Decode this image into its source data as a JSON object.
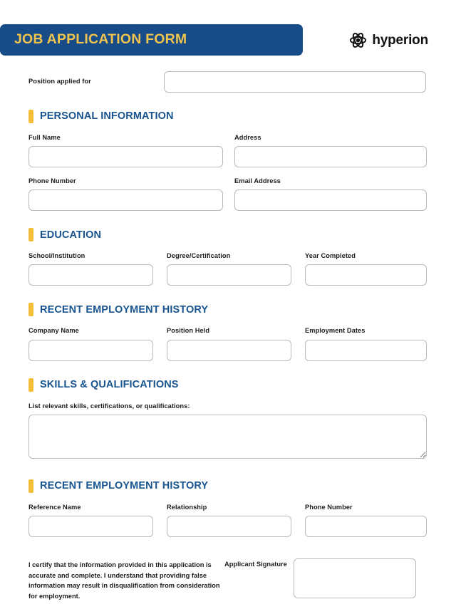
{
  "header": {
    "title": "JOB APPLICATION FORM",
    "brand_name": "hyperion",
    "brand_icon": "atom-icon",
    "bar_color": "#174c89",
    "title_color": "#efc44e",
    "accent_color": "#f5be39",
    "section_title_color": "#18548f"
  },
  "position": {
    "label": "Position applied for",
    "value": "",
    "placeholder": ""
  },
  "sections": [
    {
      "title": "PERSONAL INFORMATION",
      "fields": [
        {
          "label": "Full Name",
          "value": "",
          "placeholder": ""
        },
        {
          "label": "Address",
          "value": "",
          "placeholder": ""
        },
        {
          "label": "Phone Number",
          "value": "",
          "placeholder": ""
        },
        {
          "label": "Email Address",
          "value": "",
          "placeholder": ""
        }
      ]
    },
    {
      "title": "EDUCATION",
      "fields": [
        {
          "label": "School/Institution",
          "value": "",
          "placeholder": ""
        },
        {
          "label": "Degree/Certification",
          "value": "",
          "placeholder": ""
        },
        {
          "label": "Year Completed",
          "value": "",
          "placeholder": ""
        }
      ]
    },
    {
      "title": "RECENT EMPLOYMENT HISTORY",
      "fields": [
        {
          "label": "Company Name",
          "value": "",
          "placeholder": ""
        },
        {
          "label": "Position Held",
          "value": "",
          "placeholder": ""
        },
        {
          "label": "Employment Dates",
          "value": "",
          "placeholder": ""
        }
      ]
    },
    {
      "title": "SKILLS & QUALIFICATIONS",
      "fields": [
        {
          "label": "List relevant skills, certifications, or qualifications:",
          "value": "",
          "placeholder": ""
        }
      ]
    },
    {
      "title": "RECENT EMPLOYMENT HISTORY",
      "fields": [
        {
          "label": "Reference Name",
          "value": "",
          "placeholder": ""
        },
        {
          "label": "Relationship",
          "value": "",
          "placeholder": ""
        },
        {
          "label": "Phone Number",
          "value": "",
          "placeholder": ""
        }
      ]
    }
  ],
  "certification": {
    "statement": "I certify that the information provided in this application is accurate and complete. I understand that providing false information may result in disqualification from consideration for employment.",
    "signature_label": "Applicant Signature",
    "signature_value": "",
    "signature_placeholder": ""
  }
}
